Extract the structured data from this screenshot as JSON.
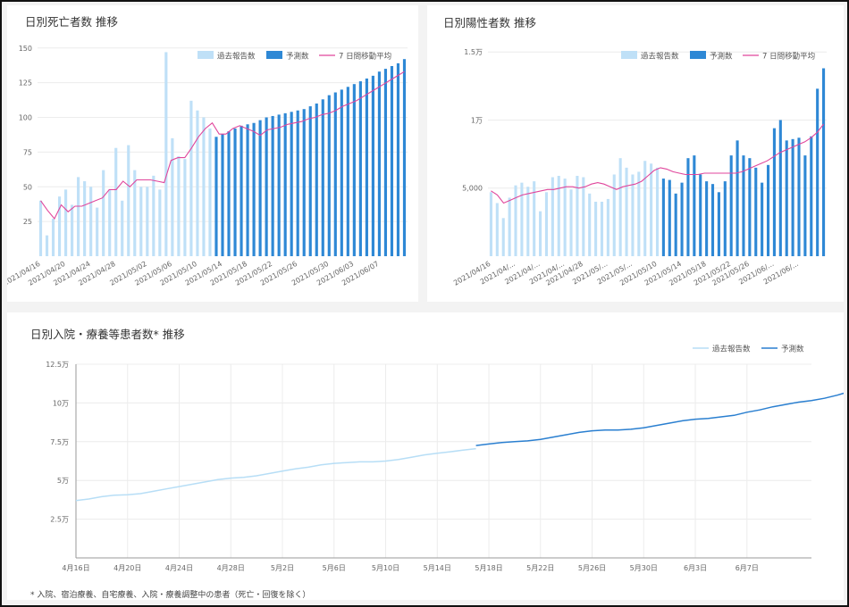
{
  "charts": {
    "deaths": {
      "title": "日別死亡者数 推移"
    },
    "positives": {
      "title": "日別陽性者数 推移"
    },
    "inpatients": {
      "title": "日別入院・療養等患者数* 推移"
    }
  },
  "footnote": "* 入院、宿泊療養、自宅療養、入院・療養調整中の患者（死亡・回復を除く）",
  "colors": {
    "past": "#bfe0f7",
    "forecast": "#2e88d5",
    "avg": "#e0469c",
    "line_past": "#b7def6",
    "line_forecast": "#2a7fd0"
  },
  "chart_data": [
    {
      "type": "bar",
      "title": "日別死亡者数 推移",
      "legend": [
        "過去報告数",
        "予測数",
        "7 日間移動平均"
      ],
      "legend_position": "top-right",
      "ylim": [
        0,
        155
      ],
      "yticks": [
        "25",
        "50",
        "75",
        "100",
        "125",
        "150"
      ],
      "xticklabels": [
        "2021/04/16",
        "2021/04/20",
        "2021/04/24",
        "2021/04/28",
        "2021/05/02",
        "2021/05/06",
        "2021/05/10",
        "2021/05/14",
        "2021/05/18",
        "2021/05/22",
        "2021/05/26",
        "2021/05/30",
        "2021/06/03",
        "2021/06/07"
      ],
      "series": [
        {
          "name": "過去報告数",
          "values": [
            40,
            15,
            27,
            43,
            48,
            37,
            57,
            54,
            50,
            35,
            62,
            48,
            78,
            40,
            80,
            62,
            50,
            50,
            58,
            48,
            147,
            85,
            72,
            70,
            112,
            105,
            100,
            92
          ]
        },
        {
          "name": "予測数",
          "values": [
            86,
            88,
            90,
            92,
            94,
            95,
            96,
            98,
            100,
            101,
            102,
            103,
            104,
            105,
            106,
            108,
            110,
            113,
            116,
            118,
            120,
            122,
            124,
            126,
            128,
            130,
            133,
            135,
            137,
            139,
            142
          ]
        },
        {
          "name": "7 日間移動平均",
          "values": [
            40,
            33,
            27,
            37,
            32,
            36,
            36,
            38,
            40,
            42,
            48,
            48,
            54,
            50,
            55,
            55,
            55,
            54,
            53,
            69,
            71,
            71,
            78,
            86,
            92,
            96,
            88,
            88,
            92,
            94,
            92,
            90,
            87,
            91,
            92,
            93,
            95,
            96,
            97,
            99,
            100,
            102,
            103,
            105,
            108,
            110,
            112,
            115,
            118,
            121,
            124,
            127,
            130,
            133
          ]
        }
      ]
    },
    {
      "type": "bar",
      "title": "日別陽性者数 推移",
      "legend": [
        "過去報告数",
        "予測数",
        "7 日間移動平均"
      ],
      "legend_position": "top-right",
      "ylim": [
        0,
        15800
      ],
      "yticks": [
        "5,000",
        "1万",
        "1.5万"
      ],
      "xticklabels": [
        "2021/04/16",
        "2021/04/...",
        "2021/04/...",
        "2021/04/...",
        "2021/04/28",
        "2021/05/...",
        "2021/05/...",
        "2021/05/10",
        "2021/05/14",
        "2021/05/18",
        "2021/05/22",
        "2021/05/26",
        "2021/06/...",
        "2021/06/..."
      ],
      "series": [
        {
          "name": "過去報告数",
          "values": [
            4700,
            3900,
            2800,
            4300,
            5200,
            5400,
            5100,
            5500,
            3300,
            4700,
            5800,
            5900,
            5700,
            4900,
            5900,
            5800,
            4600,
            4000,
            4000,
            4200,
            6000,
            7200,
            6500,
            6000,
            6200,
            7000,
            6800,
            6500
          ]
        },
        {
          "name": "予測数",
          "values": [
            5700,
            5600,
            4600,
            5400,
            7200,
            7400,
            6000,
            5500,
            5300,
            4700,
            5500,
            7400,
            8500,
            7400,
            7200,
            6500,
            5400,
            6700,
            9400,
            10000,
            8500,
            8600,
            8700,
            7400,
            8800,
            12300,
            13800
          ]
        },
        {
          "name": "7 日間移動平均",
          "values": [
            4800,
            4500,
            3900,
            4100,
            4300,
            4500,
            4600,
            4700,
            4800,
            4900,
            4900,
            5000,
            5100,
            5100,
            5000,
            5100,
            5300,
            5400,
            5300,
            5100,
            4900,
            5100,
            5200,
            5300,
            5500,
            5900,
            6300,
            6500,
            6400,
            6200,
            6100,
            6000,
            6000,
            6000,
            6100,
            6100,
            6100,
            6100,
            6100,
            6100,
            6200,
            6400,
            6600,
            6800,
            7000,
            7300,
            7600,
            7800,
            8000,
            8200,
            8400,
            8700,
            9100,
            9700
          ]
        }
      ]
    },
    {
      "type": "line",
      "title": "日別入院・療養等患者数* 推移",
      "legend": [
        "過去報告数",
        "予測数"
      ],
      "legend_position": "top-right",
      "ylim": [
        0,
        125000
      ],
      "yticks": [
        "2.5万",
        "5万",
        "7.5万",
        "10万",
        "12.5万"
      ],
      "xticklabels": [
        "4月16日",
        "4月20日",
        "4月24日",
        "4月28日",
        "5月2日",
        "5月6日",
        "5月10日",
        "5月14日",
        "5月18日",
        "5月22日",
        "5月26日",
        "5月30日",
        "6月3日",
        "6月7日"
      ],
      "x_start": "2021-04-16",
      "series": [
        {
          "name": "過去報告数",
          "x_start": "2021-04-16",
          "values": [
            37000,
            38000,
            39500,
            40500,
            40800,
            41500,
            43000,
            44500,
            46000,
            47500,
            49000,
            50500,
            51500,
            52000,
            53000,
            54500,
            56000,
            57500,
            58500,
            60000,
            61000,
            61500,
            62000,
            62000,
            62500,
            63500,
            65000,
            66500,
            67500,
            68500,
            69500,
            70500
          ]
        },
        {
          "name": "予測数",
          "x_start": "2021-05-17",
          "values": [
            72500,
            73500,
            74500,
            75000,
            75500,
            76500,
            78000,
            79500,
            81000,
            82000,
            82500,
            82500,
            83000,
            84000,
            85500,
            87000,
            88500,
            89500,
            90000,
            91000,
            92000,
            94000,
            95500,
            97500,
            99000,
            100500,
            101500,
            103000,
            105000,
            107500,
            110000
          ]
        }
      ]
    }
  ]
}
